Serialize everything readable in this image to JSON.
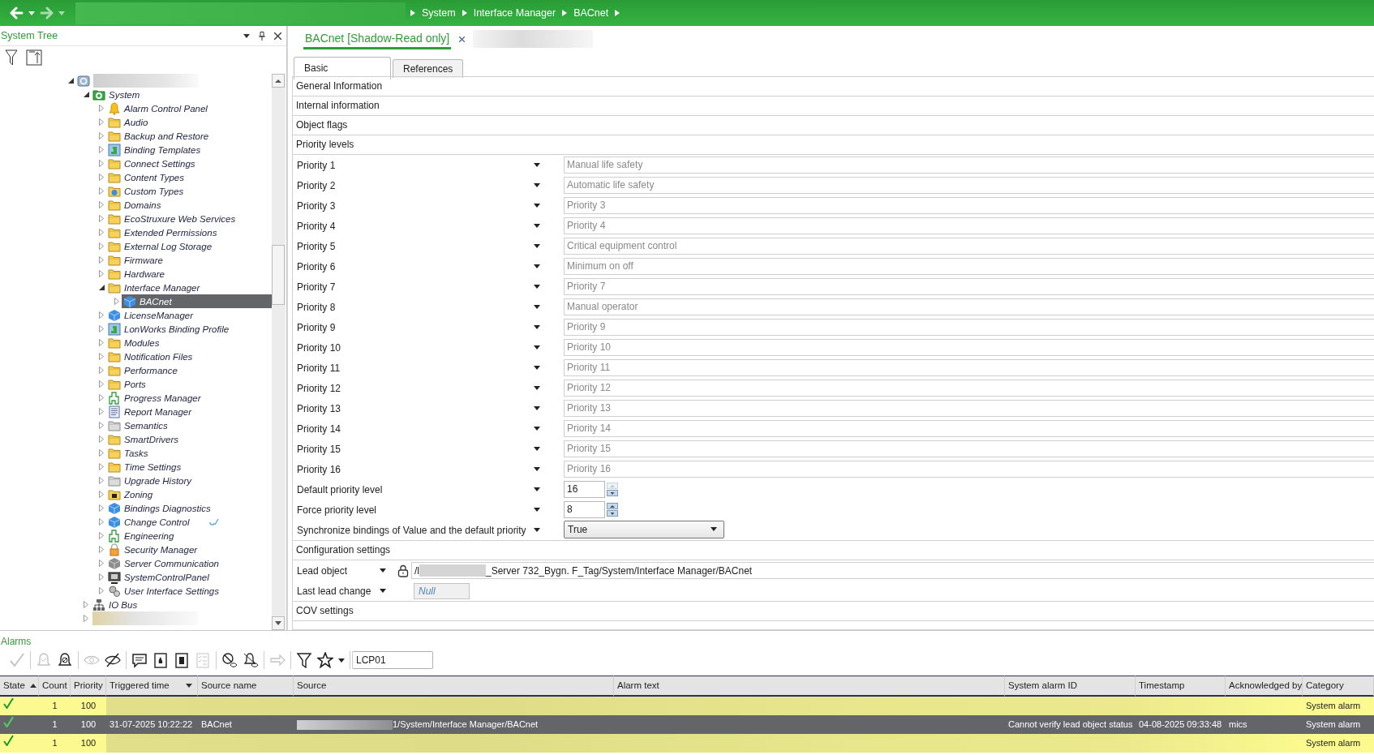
{
  "nav": [
    {
      "kind": "back",
      "disabled": false
    },
    {
      "kind": "forward",
      "disabled": true
    }
  ],
  "breadcrumb": [
    "System",
    "Interface Manager",
    "BACnet"
  ],
  "tree": {
    "title": "System Tree",
    "items": [
      {
        "kind": "server",
        "expanded": true,
        "selected": false,
        "flagged": false,
        "children": [
          {
            "label": "System",
            "kind": "system",
            "expanded": true,
            "selected": false,
            "flagged": false,
            "children": [
              {
                "label": "Alarm Control Panel",
                "kind": "bell",
                "expanded": false,
                "selected": false,
                "flagged": false
              },
              {
                "label": "Audio",
                "kind": "folder",
                "expanded": false,
                "selected": false,
                "flagged": false
              },
              {
                "label": "Backup and Restore",
                "kind": "folder",
                "expanded": false,
                "selected": false,
                "flagged": false
              },
              {
                "label": "Binding Templates",
                "kind": "binding",
                "expanded": false,
                "selected": false,
                "flagged": false
              },
              {
                "label": "Connect Settings",
                "kind": "folder",
                "expanded": false,
                "selected": false,
                "flagged": false
              },
              {
                "label": "Content Types",
                "kind": "folder",
                "expanded": false,
                "selected": false,
                "flagged": false
              },
              {
                "label": "Custom Types",
                "kind": "globe-folder",
                "expanded": false,
                "selected": false,
                "flagged": false
              },
              {
                "label": "Domains",
                "kind": "folder",
                "expanded": false,
                "selected": false,
                "flagged": false
              },
              {
                "label": "EcoStruxure Web Services",
                "kind": "folder",
                "expanded": false,
                "selected": false,
                "flagged": false
              },
              {
                "label": "Extended Permissions",
                "kind": "folder",
                "expanded": false,
                "selected": false,
                "flagged": false
              },
              {
                "label": "External Log Storage",
                "kind": "folder",
                "expanded": false,
                "selected": false,
                "flagged": false
              },
              {
                "label": "Firmware",
                "kind": "folder",
                "expanded": false,
                "selected": false,
                "flagged": false
              },
              {
                "label": "Hardware",
                "kind": "folder",
                "expanded": false,
                "selected": false,
                "flagged": false
              },
              {
                "label": "Interface Manager",
                "kind": "folder",
                "expanded": true,
                "selected": false,
                "flagged": false,
                "children": [
                  {
                    "label": "BACnet",
                    "kind": "cube",
                    "expanded": false,
                    "selected": true,
                    "flagged": false
                  }
                ]
              },
              {
                "label": "LicenseManager",
                "kind": "cube",
                "expanded": false,
                "selected": false,
                "flagged": false
              },
              {
                "label": "LonWorks Binding Profile",
                "kind": "binding",
                "expanded": false,
                "selected": false,
                "flagged": false
              },
              {
                "label": "Modules",
                "kind": "folder",
                "expanded": false,
                "selected": false,
                "flagged": false
              },
              {
                "label": "Notification Files",
                "kind": "folder",
                "expanded": false,
                "selected": false,
                "flagged": false
              },
              {
                "label": "Performance",
                "kind": "folder",
                "expanded": false,
                "selected": false,
                "flagged": false
              },
              {
                "label": "Ports",
                "kind": "folder",
                "expanded": false,
                "selected": false,
                "flagged": false
              },
              {
                "label": "Progress Manager",
                "kind": "flowchart",
                "expanded": false,
                "selected": false,
                "flagged": false
              },
              {
                "label": "Report Manager",
                "kind": "report",
                "expanded": false,
                "selected": false,
                "flagged": false
              },
              {
                "label": "Semantics",
                "kind": "gray-folder",
                "expanded": false,
                "selected": false,
                "flagged": false
              },
              {
                "label": "SmartDrivers",
                "kind": "folder",
                "expanded": false,
                "selected": false,
                "flagged": false
              },
              {
                "label": "Tasks",
                "kind": "folder",
                "expanded": false,
                "selected": false,
                "flagged": false
              },
              {
                "label": "Time Settings",
                "kind": "folder",
                "expanded": false,
                "selected": false,
                "flagged": false
              },
              {
                "label": "Upgrade History",
                "kind": "gray-folder",
                "expanded": false,
                "selected": false,
                "flagged": false
              },
              {
                "label": "Zoning",
                "kind": "zoning",
                "expanded": false,
                "selected": false,
                "flagged": false
              },
              {
                "label": "Bindings Diagnostics",
                "kind": "cube",
                "expanded": false,
                "selected": false,
                "flagged": false
              },
              {
                "label": "Change Control",
                "kind": "cube",
                "expanded": false,
                "selected": false,
                "flagged": true
              },
              {
                "label": "Engineering",
                "kind": "flowchart",
                "expanded": false,
                "selected": false,
                "flagged": false
              },
              {
                "label": "Security Manager",
                "kind": "lock",
                "expanded": false,
                "selected": false,
                "flagged": false
              },
              {
                "label": "Server Communication",
                "kind": "gray-cube",
                "expanded": false,
                "selected": false,
                "flagged": false
              },
              {
                "label": "SystemControlPanel",
                "kind": "monitor",
                "expanded": false,
                "selected": false,
                "flagged": false
              },
              {
                "label": "User Interface Settings",
                "kind": "gears",
                "expanded": false,
                "selected": false,
                "flagged": false
              }
            ]
          },
          {
            "label": "IO Bus",
            "kind": "network",
            "expanded": false,
            "selected": false,
            "flagged": false
          },
          {
            "kind": "redacted",
            "expanded": false,
            "selected": false,
            "flagged": false
          }
        ]
      }
    ]
  },
  "document_tab": {
    "title": "BACnet [Shadow-Read only]"
  },
  "tabs": [
    {
      "label": "Basic",
      "selected": true
    },
    {
      "label": "References",
      "selected": false
    }
  ],
  "sections": [
    {
      "title": "General Information"
    },
    {
      "title": "Internal information"
    },
    {
      "title": "Object flags"
    },
    {
      "title": "Priority levels",
      "properties": [
        {
          "kind": "text",
          "label": "Priority 1",
          "value": "Manual life safety"
        },
        {
          "kind": "text",
          "label": "Priority 2",
          "value": "Automatic life safety"
        },
        {
          "kind": "text",
          "label": "Priority 3",
          "value": "Priority 3"
        },
        {
          "kind": "text",
          "label": "Priority 4",
          "value": "Priority 4"
        },
        {
          "kind": "text",
          "label": "Priority 5",
          "value": "Critical equipment control"
        },
        {
          "kind": "text",
          "label": "Priority 6",
          "value": "Minimum on off"
        },
        {
          "kind": "text",
          "label": "Priority 7",
          "value": "Priority 7"
        },
        {
          "kind": "text",
          "label": "Priority 8",
          "value": "Manual operator"
        },
        {
          "kind": "text",
          "label": "Priority 9",
          "value": "Priority 9"
        },
        {
          "kind": "text",
          "label": "Priority 10",
          "value": "Priority 10"
        },
        {
          "kind": "text",
          "label": "Priority 11",
          "value": "Priority 11"
        },
        {
          "kind": "text",
          "label": "Priority 12",
          "value": "Priority 12"
        },
        {
          "kind": "text",
          "label": "Priority 13",
          "value": "Priority 13"
        },
        {
          "kind": "text",
          "label": "Priority 14",
          "value": "Priority 14"
        },
        {
          "kind": "text",
          "label": "Priority 15",
          "value": "Priority 15"
        },
        {
          "kind": "text",
          "label": "Priority 16",
          "value": "Priority 16"
        },
        {
          "kind": "spin",
          "label": "Default priority level",
          "value": "16",
          "up_disabled": true
        },
        {
          "kind": "spin",
          "label": "Force priority level",
          "value": "8",
          "up_disabled": false
        },
        {
          "kind": "select",
          "label": "Synchronize bindings of Value and the default priority",
          "value": "True"
        }
      ]
    },
    {
      "title": "Configuration settings",
      "properties": [
        {
          "kind": "path",
          "label": "Lead object",
          "value_start": "/l",
          "value_end": "_Server 732_Bygn. F_Tag/System/Interface Manager/BACnet"
        },
        {
          "kind": "null",
          "label": "Last lead change",
          "value": "Null"
        }
      ]
    },
    {
      "title": "COV settings"
    }
  ],
  "alarms": {
    "title": "Alarms",
    "toolbar": [
      [
        {
          "kind": "check",
          "disabled": true
        }
      ],
      [
        {
          "kind": "bell-check",
          "disabled": true
        },
        {
          "kind": "bell-x",
          "disabled": false
        }
      ],
      [
        {
          "kind": "eye",
          "disabled": true
        },
        {
          "kind": "eye-slash",
          "disabled": false
        }
      ],
      [
        {
          "kind": "comment",
          "disabled": false
        },
        {
          "kind": "flame-book",
          "disabled": false
        },
        {
          "kind": "list-book",
          "disabled": false
        },
        {
          "kind": "checklist",
          "disabled": true
        }
      ],
      [
        {
          "kind": "no-entry",
          "disabled": false
        },
        {
          "kind": "bell-slash",
          "disabled": false
        }
      ],
      [
        {
          "kind": "arrow",
          "disabled": true
        }
      ],
      [
        {
          "kind": "filter",
          "disabled": false
        },
        {
          "kind": "star",
          "disabled": false
        }
      ]
    ],
    "search": {
      "value": "LCP01"
    },
    "columns": [
      {
        "title": "State",
        "sorted": true,
        "dropdown": false
      },
      {
        "title": "Count",
        "sorted": false,
        "dropdown": false
      },
      {
        "title": "Priority",
        "sorted": false,
        "dropdown": false
      },
      {
        "title": "Triggered time",
        "sorted": false,
        "dropdown": true
      },
      {
        "title": "Source name",
        "sorted": false,
        "dropdown": false
      },
      {
        "title": "Source",
        "sorted": false,
        "dropdown": false
      },
      {
        "title": "Alarm text",
        "sorted": false,
        "dropdown": false
      },
      {
        "title": "System alarm ID",
        "sorted": false,
        "dropdown": false
      },
      {
        "title": "Timestamp",
        "sorted": false,
        "dropdown": false
      },
      {
        "title": "Acknowledged by",
        "sorted": false,
        "dropdown": false
      },
      {
        "title": "Category",
        "sorted": false,
        "dropdown": false
      }
    ],
    "rows": [
      {
        "selected": false,
        "redacted": true,
        "count": "1",
        "priority": "100",
        "category": "System alarm"
      },
      {
        "selected": true,
        "redacted": false,
        "count": "1",
        "priority": "100",
        "triggered_time": "31-07-2025 10:22:22",
        "source_name": "BACnet",
        "source": "1/System/Interface Manager/BACnet",
        "system_alarm_id": "Cannot verify lead object status",
        "timestamp": "04-08-2025 09:33:48",
        "acknowledged_by": "mics",
        "category": "System alarm"
      },
      {
        "selected": false,
        "redacted": true,
        "count": "1",
        "priority": "100",
        "category": "System alarm"
      }
    ]
  }
}
